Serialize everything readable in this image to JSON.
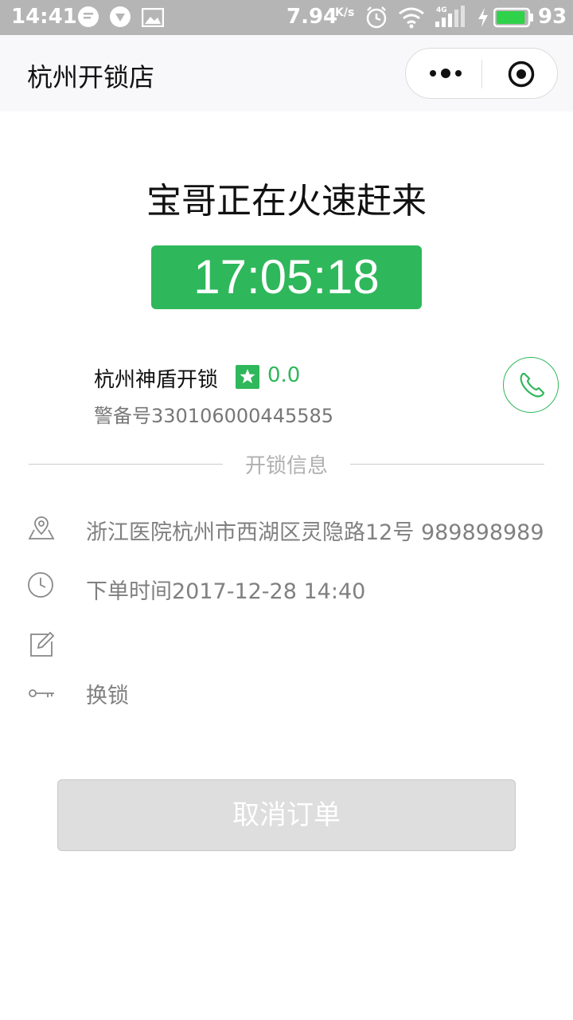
{
  "status_bar": {
    "time": "14:41",
    "net_speed": "7.94",
    "net_speed_unit": "K/s",
    "network_label": "4G",
    "battery_percent": "93",
    "battery_level": 0.93
  },
  "title_bar": {
    "title": "杭州开锁店",
    "more_icon": "more-dots-icon",
    "close_icon": "target-circle-icon"
  },
  "main": {
    "headline": "宝哥正在火速赶来",
    "countdown": "17:05:18",
    "shop": {
      "name": "杭州神盾开锁",
      "rating": "0.0",
      "license": "警备号330106000445585"
    },
    "section_title": "开锁信息",
    "info": {
      "address": "浙江医院杭州市西湖区灵隐路12号 989898989",
      "order_time": "下单时间2017-12-28 14:40",
      "note": "",
      "service": "换锁"
    },
    "cancel_label": "取消订单"
  },
  "colors": {
    "accent": "#2fb75b",
    "status_bar_bg": "#b5b5b5",
    "muted_text": "#808080"
  }
}
